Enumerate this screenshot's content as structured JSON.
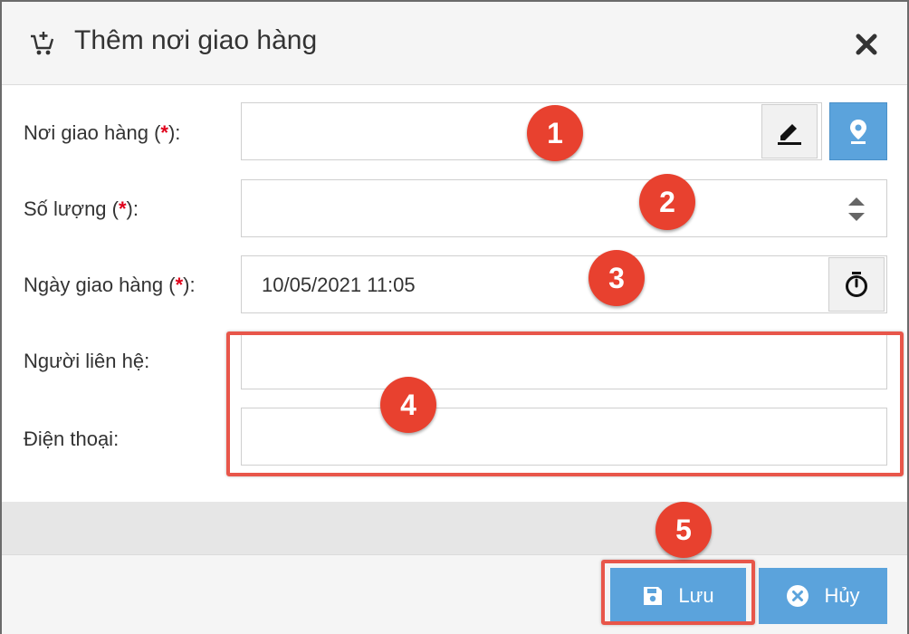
{
  "dialog": {
    "title": "Thêm nơi giao hàng",
    "header_icon": "cart-plus-icon",
    "close_icon": "close-icon"
  },
  "form": {
    "fields": [
      {
        "label": "Nơi giao hàng (",
        "required_mark": "*",
        "label_end": "):",
        "value": ""
      },
      {
        "label": "Số lượng (",
        "required_mark": "*",
        "label_end": "):",
        "value": ""
      },
      {
        "label": "Ngày giao hàng (",
        "required_mark": "*",
        "label_end": "):",
        "value": "10/05/2021 11:05"
      },
      {
        "label": "Người liên hệ:",
        "value": ""
      },
      {
        "label": "Điện thoại:",
        "value": ""
      }
    ]
  },
  "annotations": [
    "1",
    "2",
    "3",
    "4",
    "5"
  ],
  "footer": {
    "save_label": "Lưu",
    "cancel_label": "Hủy"
  },
  "colors": {
    "accent": "#5ba3dc",
    "annotation": "#e8412f",
    "required": "#e0001b"
  }
}
